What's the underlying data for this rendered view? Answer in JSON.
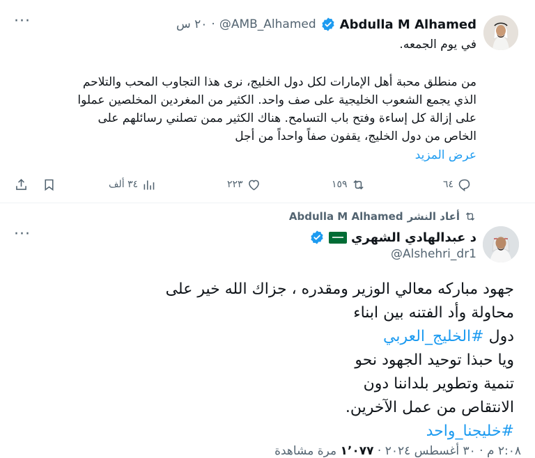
{
  "tweet": {
    "author_name": "Abdulla M Alhamed",
    "author_handle": "@AMB_Alhamed",
    "separator": "·",
    "time": "٢٠ س",
    "lines": [
      "في يوم الجمعه.",
      "",
      "من منطلق محبة أهل الإمارات لكل دول الخليج، نرى هذا التجاوب المحب والتلاحم",
      "الذي يجمع الشعوب الخليجية على صف واحد. الكثير من المغردين المخلصين عملوا",
      "على إزالة كل إساءة وفتح باب التسامح. هناك الكثير ممن تصلني رسائلهم على",
      "الخاص من دول الخليج، يقفون صفاً واحداً من أجل"
    ],
    "show_more": "عرض المزيد",
    "actions": {
      "replies": "٦٤",
      "retweets": "١٥٩",
      "likes": "٢٢٣",
      "views": "٣٤ ألف"
    }
  },
  "retweet_notice": {
    "retweeter": "Abdulla M Alhamed",
    "verb": "أعاد النشر"
  },
  "tweet2": {
    "author_name": "د عبدالهادي الشهري",
    "author_handle": "@Alshehri_dr1",
    "lines": [
      {
        "text": "جهود مباركه معالي الوزير ومقدره ، جزاك الله خير على"
      },
      {
        "text": "محاولة وأد الفتنه بين ابناء"
      },
      {
        "text": "دول ",
        "hashtag": "#الخليج_العربي"
      },
      {
        "text": "ويا حبذا توحيد الجهود نحو"
      },
      {
        "text": "تنمية وتطوير بلداننا دون"
      },
      {
        "text": "الانتقاص من عمل الآخرين."
      },
      {
        "text": "",
        "hashtag": "#خليجنا_واحد"
      }
    ],
    "meta": {
      "time_date": "٢:٠٨ م · ٣٠ أغسطس ٢٠٢٤ ·",
      "views_count": "١٬٠٧٧",
      "views_label": "مرة مشاهدة"
    }
  },
  "colors": {
    "accent": "#1d9bf0",
    "muted": "#536471",
    "text": "#0f1419",
    "flag": "#006c35"
  },
  "icons": [
    "more-icon",
    "verified-badge-icon",
    "reply-icon",
    "retweet-icon",
    "like-icon",
    "views-icon",
    "bookmark-icon",
    "share-icon",
    "saudi-flag-icon"
  ]
}
